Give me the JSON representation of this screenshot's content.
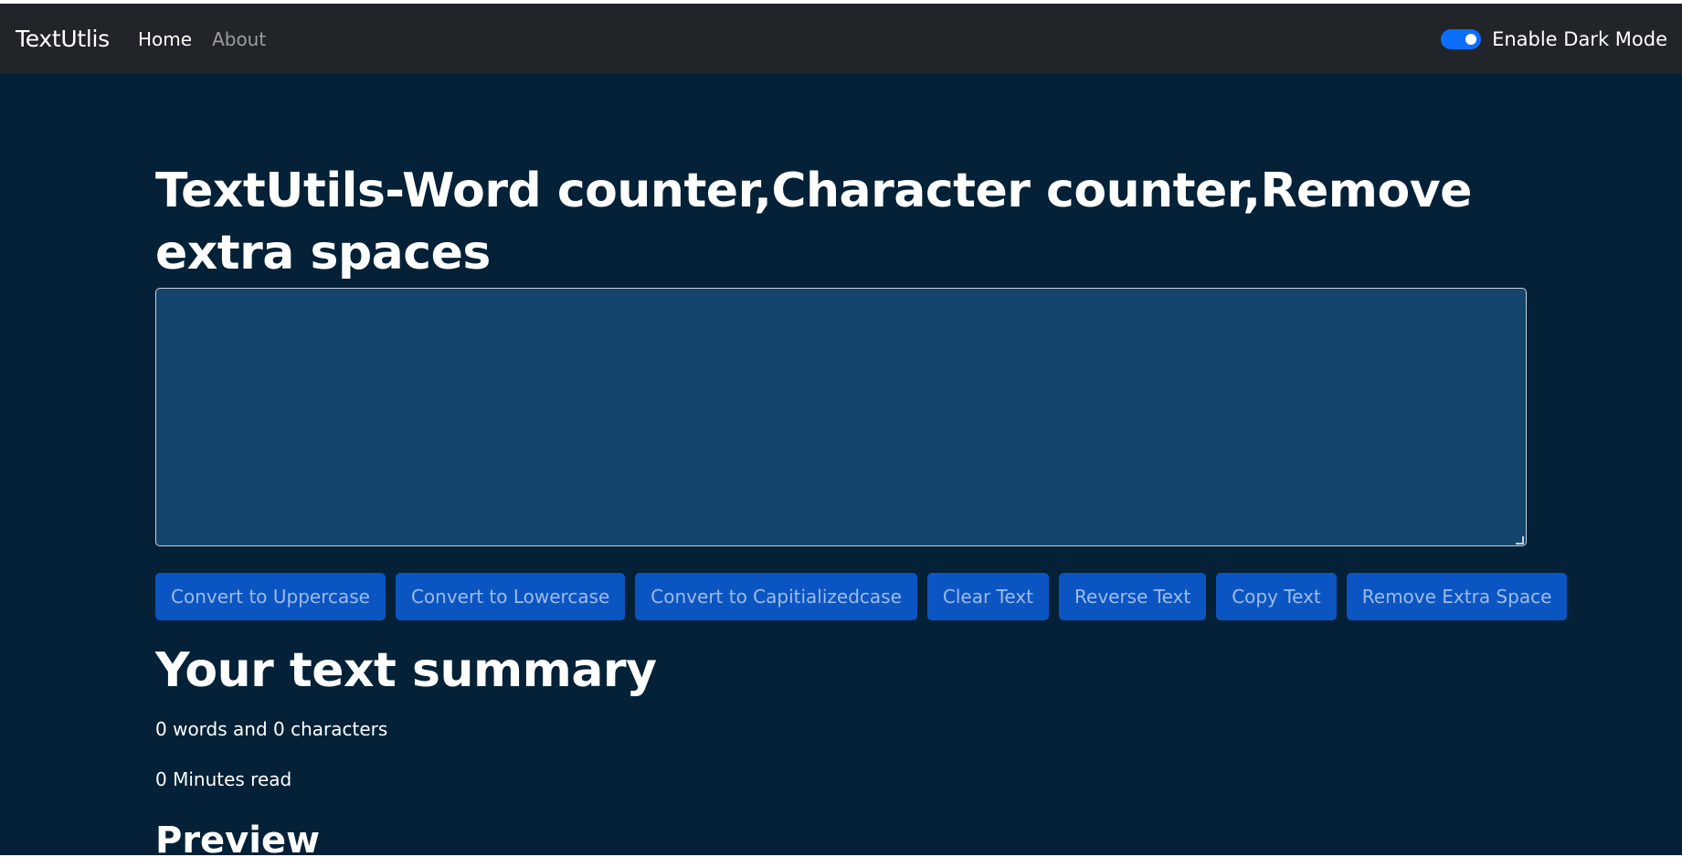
{
  "navbar": {
    "brand": "TextUtlis",
    "links": [
      {
        "label": "Home",
        "active": true
      },
      {
        "label": "About",
        "active": false
      }
    ],
    "dark_mode": {
      "label": "Enable Dark Mode",
      "enabled": true
    }
  },
  "main": {
    "heading": "TextUtils-Word counter,Character counter,Remove extra spaces",
    "textarea_value": "",
    "buttons": [
      "Convert to Uppercase",
      "Convert to Lowercase",
      "Convert to Capitializedcase",
      "Clear Text",
      "Reverse Text",
      "Copy Text",
      "Remove Extra Space"
    ],
    "summary_heading": "Your text summary",
    "word_char_count": "0 words and 0 characters",
    "minutes_read": "0 Minutes read",
    "preview_heading": "Preview"
  },
  "colors": {
    "navbar_bg": "#212529",
    "page_bg": "#042137",
    "textarea_bg": "#13456d",
    "button_bg": "#0b55c2",
    "toggle_accent": "#0d6efd"
  }
}
